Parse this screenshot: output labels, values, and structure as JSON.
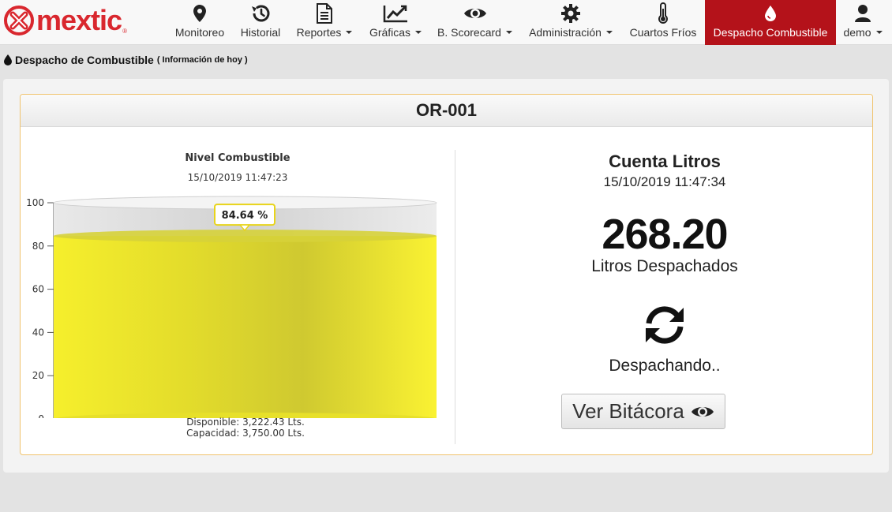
{
  "brand": {
    "name": "mextic",
    "registered": "®"
  },
  "nav": [
    {
      "label": "Monitoreo",
      "icon": "map-marker-icon",
      "dropdown": false,
      "active": false
    },
    {
      "label": "Historial",
      "icon": "history-icon",
      "dropdown": false,
      "active": false
    },
    {
      "label": "Reportes",
      "icon": "file-text-icon",
      "dropdown": true,
      "active": false
    },
    {
      "label": "Gráficas",
      "icon": "line-chart-icon",
      "dropdown": true,
      "active": false
    },
    {
      "label": "B. Scorecard",
      "icon": "eye-icon",
      "dropdown": true,
      "active": false
    },
    {
      "label": "Administración",
      "icon": "gear-icon",
      "dropdown": true,
      "active": false
    },
    {
      "label": "Cuartos Fríos",
      "icon": "thermometer-icon",
      "dropdown": false,
      "active": false
    },
    {
      "label": "Despacho Combustible",
      "icon": "fuel-drop-icon",
      "dropdown": false,
      "active": true
    },
    {
      "label": "demo",
      "icon": "user-icon",
      "dropdown": true,
      "active": false
    }
  ],
  "page": {
    "title": "Despacho de Combustible",
    "subtitle": "( Información de hoy )"
  },
  "card": {
    "title": "OR-001"
  },
  "gauge": {
    "title": "Nivel Combustible",
    "timestamp": "15/10/2019 11:47:23",
    "value_label": "84.64 %",
    "available": "Disponible: 3,222.43 Lts.",
    "capacity": "Capacidad: 3,750.00 Lts."
  },
  "chart_data": {
    "type": "cylinder-gauge",
    "title": "Nivel Combustible",
    "subtitle": "15/10/2019 11:47:23",
    "value": 84.64,
    "unit": "%",
    "ylim": [
      0,
      100
    ],
    "yticks": [
      "0",
      "20",
      "40",
      "60",
      "80",
      "100"
    ],
    "fill_color": "#f3ec2a"
  },
  "counter": {
    "title": "Cuenta Litros",
    "timestamp": "15/10/2019 11:47:34",
    "value": "268.20",
    "unit": "Litros Despachados",
    "status": "Despachando..",
    "status_icon": "refresh-icon"
  },
  "actions": {
    "log_button": "Ver Bitácora"
  },
  "colors": {
    "brand": "#d9272e",
    "active_nav": "#b4121a",
    "card_border": "#f0c36d"
  }
}
